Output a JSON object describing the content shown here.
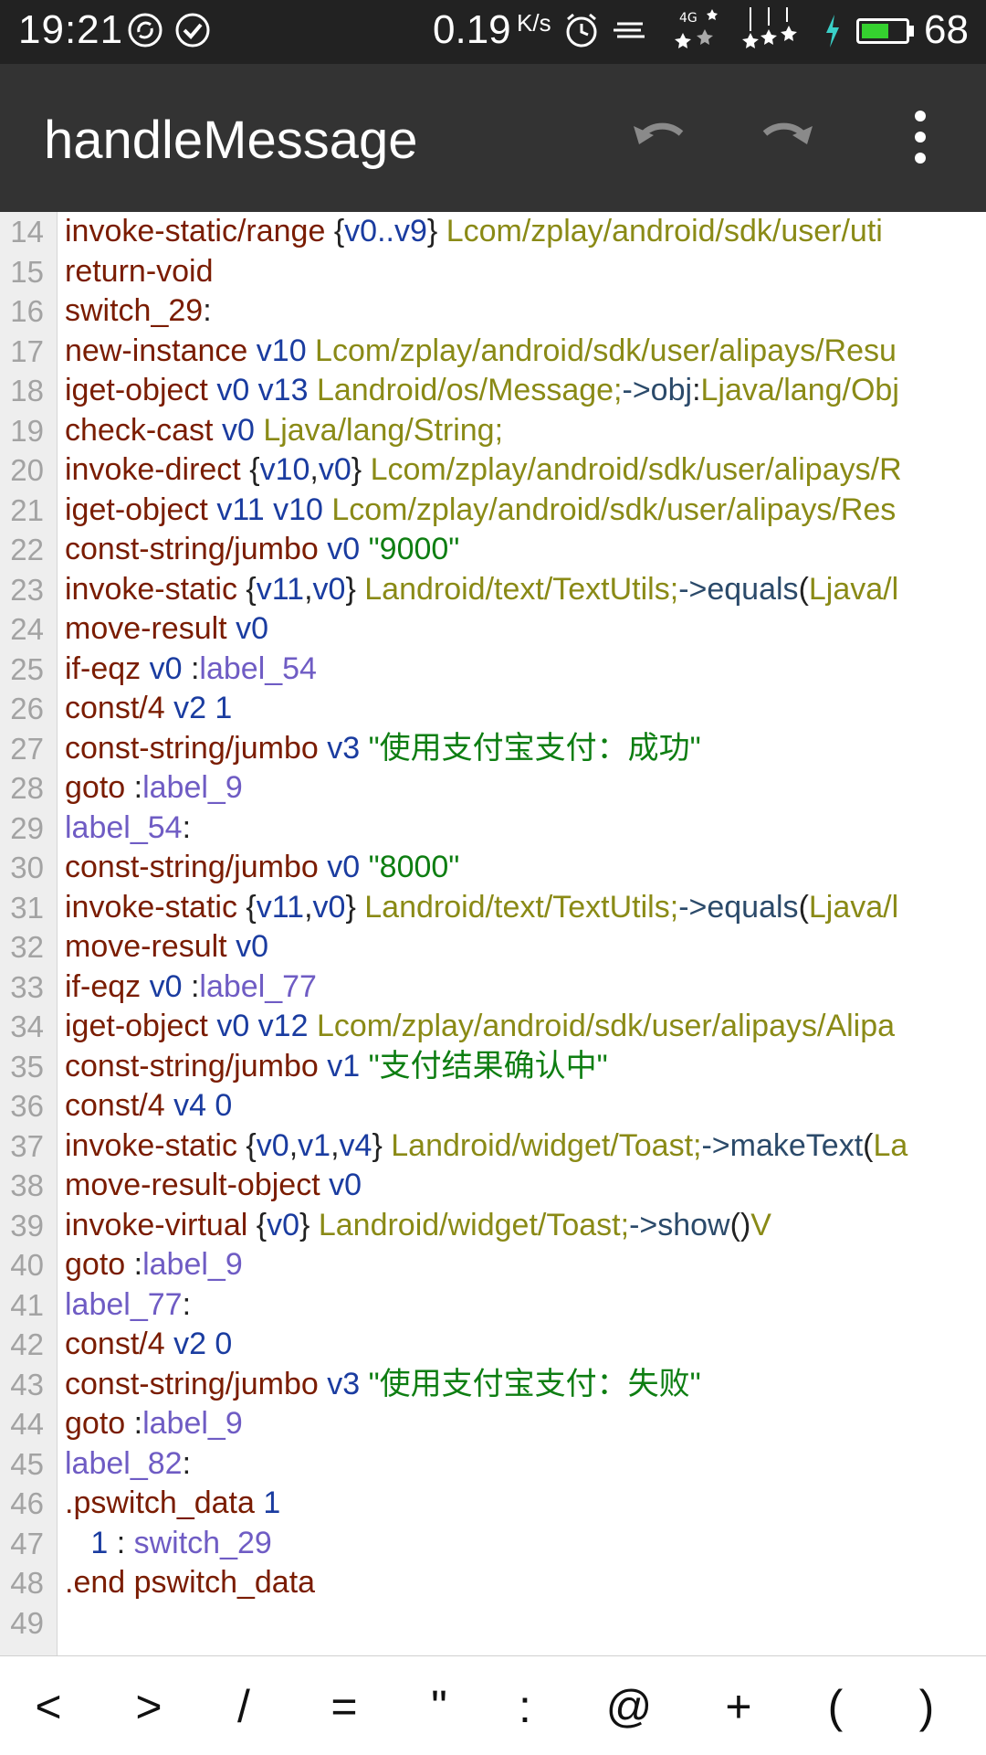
{
  "status_bar": {
    "time": "19:21",
    "net_speed": "0.19",
    "net_unit": "K/s",
    "battery_level": "68",
    "battery_fraction": 0.68,
    "icons": [
      "sync-icon",
      "check-circle-icon",
      "alarm-clock-icon",
      "signal-lines-icon",
      "signal-4g-icon",
      "signal-bars-icon",
      "charging-bolt-icon",
      "battery-icon"
    ]
  },
  "app_bar": {
    "title": "handleMessage",
    "actions": [
      "undo-icon",
      "redo-icon",
      "more-vert-icon"
    ]
  },
  "editor": {
    "colors": {
      "keyword": "#7a1c00",
      "register": "#1a3ca0",
      "class": "#8a8a16",
      "string": "#0e7e12",
      "label": "#6f5cc4",
      "method": "#2b4a6a",
      "plain": "#222222",
      "gutter_text": "#a3a3a3"
    },
    "lines": [
      {
        "n": "14",
        "tokens": [
          [
            "kw",
            "invoke-static/range "
          ],
          [
            "pl",
            "{"
          ],
          [
            "reg",
            "v0..v9"
          ],
          [
            "pl",
            "} "
          ],
          [
            "cls",
            "Lcom/zplay/android/sdk/user/uti"
          ]
        ]
      },
      {
        "n": "15",
        "tokens": [
          [
            "kw",
            "return-void"
          ]
        ]
      },
      {
        "n": "16",
        "tokens": [
          [
            "kw",
            "switch_29"
          ],
          [
            "pl",
            ":"
          ]
        ]
      },
      {
        "n": "17",
        "tokens": [
          [
            "kw",
            "new-instance "
          ],
          [
            "reg",
            "v10 "
          ],
          [
            "cls",
            "Lcom/zplay/android/sdk/user/alipays/Resu"
          ]
        ]
      },
      {
        "n": "18",
        "tokens": [
          [
            "kw",
            "iget-object "
          ],
          [
            "reg",
            "v0 v13 "
          ],
          [
            "cls",
            "Landroid/os/Message;"
          ],
          [
            "mth",
            "->obj"
          ],
          [
            "pl",
            ":"
          ],
          [
            "cls",
            "Ljava/lang/Obj"
          ]
        ]
      },
      {
        "n": "19",
        "tokens": [
          [
            "kw",
            "check-cast "
          ],
          [
            "reg",
            "v0 "
          ],
          [
            "cls",
            "Ljava/lang/String;"
          ]
        ]
      },
      {
        "n": "20",
        "tokens": [
          [
            "kw",
            "invoke-direct "
          ],
          [
            "pl",
            "{"
          ],
          [
            "reg",
            "v10"
          ],
          [
            "pl",
            ","
          ],
          [
            "reg",
            "v0"
          ],
          [
            "pl",
            "} "
          ],
          [
            "cls",
            "Lcom/zplay/android/sdk/user/alipays/R"
          ]
        ]
      },
      {
        "n": "21",
        "tokens": [
          [
            "kw",
            "iget-object "
          ],
          [
            "reg",
            "v11 v10 "
          ],
          [
            "cls",
            "Lcom/zplay/android/sdk/user/alipays/Res"
          ]
        ]
      },
      {
        "n": "22",
        "tokens": [
          [
            "kw",
            "const-string/jumbo "
          ],
          [
            "reg",
            "v0 "
          ],
          [
            "str",
            "\"9000\""
          ]
        ]
      },
      {
        "n": "23",
        "tokens": [
          [
            "kw",
            "invoke-static "
          ],
          [
            "pl",
            "{"
          ],
          [
            "reg",
            "v11"
          ],
          [
            "pl",
            ","
          ],
          [
            "reg",
            "v0"
          ],
          [
            "pl",
            "} "
          ],
          [
            "cls",
            "Landroid/text/TextUtils;"
          ],
          [
            "mth",
            "->equals"
          ],
          [
            "pl",
            "("
          ],
          [
            "cls",
            "Ljava/l"
          ]
        ]
      },
      {
        "n": "24",
        "tokens": [
          [
            "kw",
            "move-result "
          ],
          [
            "reg",
            "v0"
          ]
        ]
      },
      {
        "n": "25",
        "tokens": [
          [
            "kw",
            "if-eqz "
          ],
          [
            "reg",
            "v0 "
          ],
          [
            "pl",
            ":"
          ],
          [
            "lbl",
            "label_54"
          ]
        ]
      },
      {
        "n": "26",
        "tokens": [
          [
            "kw",
            "const/4 "
          ],
          [
            "reg",
            "v2 1"
          ]
        ]
      },
      {
        "n": "27",
        "tokens": [
          [
            "kw",
            "const-string/jumbo "
          ],
          [
            "reg",
            "v3 "
          ],
          [
            "str",
            "\"使用支付宝支付：成功\""
          ]
        ]
      },
      {
        "n": "28",
        "tokens": [
          [
            "kw",
            "goto "
          ],
          [
            "pl",
            ":"
          ],
          [
            "lbl",
            "label_9"
          ]
        ]
      },
      {
        "n": "29",
        "tokens": [
          [
            "lbl",
            "label_54"
          ],
          [
            "pl",
            ":"
          ]
        ]
      },
      {
        "n": "30",
        "tokens": [
          [
            "kw",
            "const-string/jumbo "
          ],
          [
            "reg",
            "v0 "
          ],
          [
            "str",
            "\"8000\""
          ]
        ]
      },
      {
        "n": "31",
        "tokens": [
          [
            "kw",
            "invoke-static "
          ],
          [
            "pl",
            "{"
          ],
          [
            "reg",
            "v11"
          ],
          [
            "pl",
            ","
          ],
          [
            "reg",
            "v0"
          ],
          [
            "pl",
            "} "
          ],
          [
            "cls",
            "Landroid/text/TextUtils;"
          ],
          [
            "mth",
            "->equals"
          ],
          [
            "pl",
            "("
          ],
          [
            "cls",
            "Ljava/l"
          ]
        ]
      },
      {
        "n": "32",
        "tokens": [
          [
            "kw",
            "move-result "
          ],
          [
            "reg",
            "v0"
          ]
        ]
      },
      {
        "n": "33",
        "tokens": [
          [
            "kw",
            "if-eqz "
          ],
          [
            "reg",
            "v0 "
          ],
          [
            "pl",
            ":"
          ],
          [
            "lbl",
            "label_77"
          ]
        ]
      },
      {
        "n": "34",
        "tokens": [
          [
            "kw",
            "iget-object "
          ],
          [
            "reg",
            "v0 v12 "
          ],
          [
            "cls",
            "Lcom/zplay/android/sdk/user/alipays/Alipa"
          ]
        ]
      },
      {
        "n": "35",
        "tokens": [
          [
            "kw",
            "const-string/jumbo "
          ],
          [
            "reg",
            "v1 "
          ],
          [
            "str",
            "\"支付结果确认中\""
          ]
        ]
      },
      {
        "n": "36",
        "tokens": [
          [
            "kw",
            "const/4 "
          ],
          [
            "reg",
            "v4 0"
          ]
        ]
      },
      {
        "n": "37",
        "tokens": [
          [
            "kw",
            "invoke-static "
          ],
          [
            "pl",
            "{"
          ],
          [
            "reg",
            "v0"
          ],
          [
            "pl",
            ","
          ],
          [
            "reg",
            "v1"
          ],
          [
            "pl",
            ","
          ],
          [
            "reg",
            "v4"
          ],
          [
            "pl",
            "} "
          ],
          [
            "cls",
            "Landroid/widget/Toast;"
          ],
          [
            "mth",
            "->makeText"
          ],
          [
            "pl",
            "("
          ],
          [
            "cls",
            "La"
          ]
        ]
      },
      {
        "n": "38",
        "tokens": [
          [
            "kw",
            "move-result-object "
          ],
          [
            "reg",
            "v0"
          ]
        ]
      },
      {
        "n": "39",
        "tokens": [
          [
            "kw",
            "invoke-virtual "
          ],
          [
            "pl",
            "{"
          ],
          [
            "reg",
            "v0"
          ],
          [
            "pl",
            "} "
          ],
          [
            "cls",
            "Landroid/widget/Toast;"
          ],
          [
            "mth",
            "->show"
          ],
          [
            "pl",
            "()"
          ],
          [
            "cls",
            "V"
          ]
        ]
      },
      {
        "n": "40",
        "tokens": [
          [
            "kw",
            "goto "
          ],
          [
            "pl",
            ":"
          ],
          [
            "lbl",
            "label_9"
          ]
        ]
      },
      {
        "n": "41",
        "tokens": [
          [
            "lbl",
            "label_77"
          ],
          [
            "pl",
            ":"
          ]
        ]
      },
      {
        "n": "42",
        "tokens": [
          [
            "kw",
            "const/4 "
          ],
          [
            "reg",
            "v2 0"
          ]
        ]
      },
      {
        "n": "43",
        "tokens": [
          [
            "kw",
            "const-string/jumbo "
          ],
          [
            "reg",
            "v3 "
          ],
          [
            "str",
            "\"使用支付宝支付：失败\""
          ]
        ]
      },
      {
        "n": "44",
        "tokens": [
          [
            "kw",
            "goto "
          ],
          [
            "pl",
            ":"
          ],
          [
            "lbl",
            "label_9"
          ]
        ]
      },
      {
        "n": "45",
        "tokens": [
          [
            "lbl",
            "label_82"
          ],
          [
            "pl",
            ":"
          ]
        ]
      },
      {
        "n": "46",
        "tokens": [
          [
            "kw",
            ".pswitch_data "
          ],
          [
            "reg",
            "1"
          ]
        ]
      },
      {
        "n": "47",
        "tokens": [
          [
            "pl",
            "   "
          ],
          [
            "reg",
            "1 "
          ],
          [
            "pl",
            ": "
          ],
          [
            "lbl",
            "switch_29"
          ]
        ]
      },
      {
        "n": "48",
        "tokens": [
          [
            "kw",
            ".end pswitch_data"
          ]
        ]
      },
      {
        "n": "49",
        "tokens": []
      }
    ]
  },
  "symbol_bar": {
    "keys": [
      "<",
      ">",
      "/",
      "=",
      "\"",
      ":",
      "@",
      "+",
      "(",
      ")"
    ]
  }
}
